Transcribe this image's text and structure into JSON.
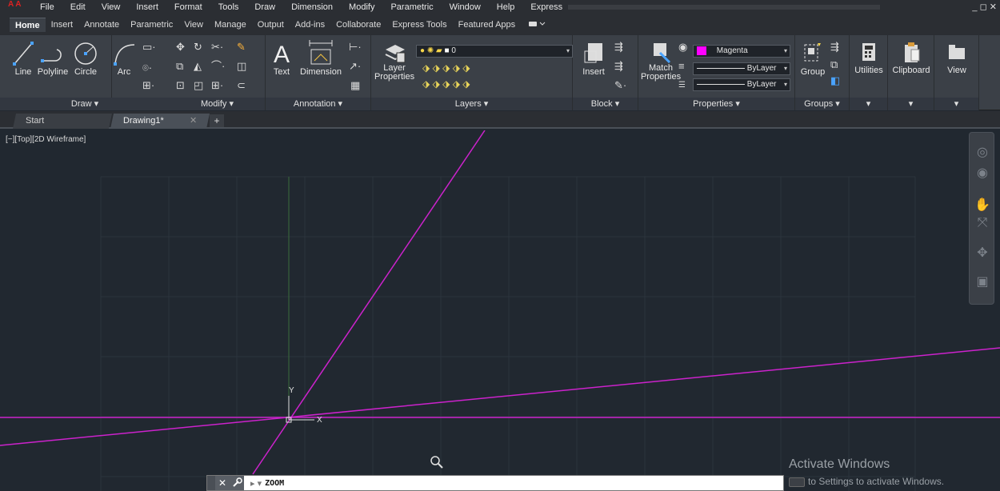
{
  "menubar": {
    "items": [
      "File",
      "Edit",
      "View",
      "Insert",
      "Format",
      "Tools",
      "Draw",
      "Dimension",
      "Modify",
      "Parametric",
      "Window",
      "Help",
      "Express"
    ],
    "window_controls": "_ ◻ ✕"
  },
  "ribbon_tabs": {
    "items": [
      "Home",
      "Insert",
      "Annotate",
      "Parametric",
      "View",
      "Manage",
      "Output",
      "Add-ins",
      "Collaborate",
      "Express Tools",
      "Featured Apps"
    ],
    "active": "Home"
  },
  "ribbon": {
    "draw": {
      "title": "Draw ▾",
      "line": "Line",
      "polyline": "Polyline",
      "circle": "Circle",
      "arc": "Arc"
    },
    "modify": {
      "title": "Modify ▾"
    },
    "annotation": {
      "title": "Annotation ▾",
      "text": "Text",
      "dimension": "Dimension"
    },
    "layers": {
      "title": "Layers ▾",
      "layer_properties_line1": "Layer",
      "layer_properties_line2": "Properties",
      "current_layer": "0"
    },
    "block": {
      "title": "Block ▾",
      "insert": "Insert"
    },
    "properties": {
      "title": "Properties ▾",
      "match_line1": "Match",
      "match_line2": "Properties",
      "color": "Magenta",
      "linetype": "ByLayer",
      "lineweight": "ByLayer"
    },
    "groups": {
      "title": "Groups ▾",
      "group": "Group"
    },
    "utilities": {
      "label": "Utilities"
    },
    "clipboard": {
      "label": "Clipboard"
    },
    "view": {
      "label": "View"
    }
  },
  "doctabs": {
    "start": "Start",
    "drawing": "Drawing1*",
    "close": "✕",
    "add": "+"
  },
  "canvas": {
    "view_label": "[−][Top][2D Wireframe]",
    "ucs_x": "X",
    "ucs_y": "Y",
    "line_color": "#cc22cc",
    "grid_color": "#2b333c"
  },
  "watermark": {
    "title": "Activate Windows",
    "subtitle": "to Settings to activate Windows."
  },
  "commandline": {
    "close": "✕",
    "prompt": "▸ ▾",
    "text": "ZOOM"
  }
}
